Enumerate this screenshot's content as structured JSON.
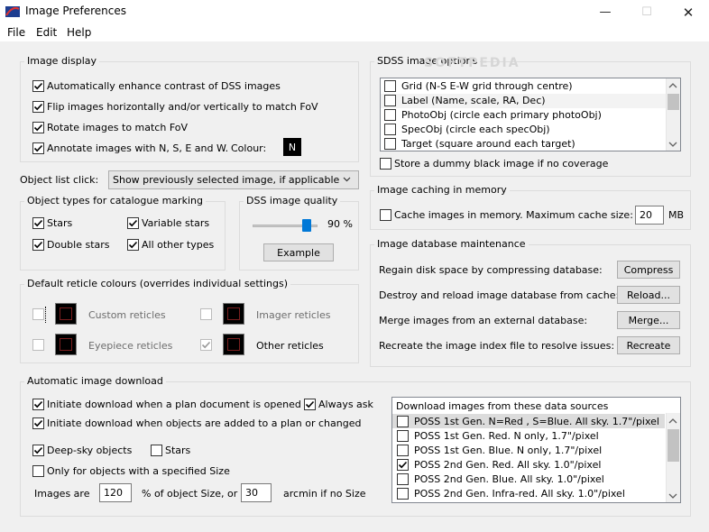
{
  "window": {
    "title": "Image Preferences"
  },
  "menu": [
    "File",
    "Edit",
    "Help"
  ],
  "watermark": "SOFTPEDIA",
  "image_display": {
    "title": "Image display",
    "items": [
      {
        "label": "Automatically enhance contrast of DSS images",
        "checked": true
      },
      {
        "label": "Flip images horizontally and/or vertically to match FoV",
        "checked": true
      },
      {
        "label": "Rotate images to match FoV",
        "checked": true
      },
      {
        "label": "Annotate images with N, S, E and W.",
        "checked": true
      }
    ],
    "colour_label": "Colour:",
    "colour_value": "N"
  },
  "object_list": {
    "label": "Object list click:",
    "value": "Show previously selected image, if applicable"
  },
  "object_types": {
    "title": "Object types for catalogue marking",
    "items": [
      {
        "label": "Stars",
        "checked": true
      },
      {
        "label": "Variable stars",
        "checked": true
      },
      {
        "label": "Double stars",
        "checked": true
      },
      {
        "label": "All other types",
        "checked": true
      }
    ]
  },
  "dss_quality": {
    "title": "DSS image quality",
    "value": "90 %",
    "level": 0.9,
    "button": "Example"
  },
  "reticle": {
    "title": "Default reticle colours (overrides individual settings)",
    "items": [
      {
        "label": "Custom reticles",
        "checked": false,
        "enabled": false
      },
      {
        "label": "Imager reticles",
        "checked": false,
        "enabled": false
      },
      {
        "label": "Eyepiece reticles",
        "checked": false,
        "enabled": false
      },
      {
        "label": "Other reticles",
        "checked": true,
        "enabled": true
      }
    ]
  },
  "sdss": {
    "title": "SDSS image options",
    "items": [
      {
        "label": "Grid (N-S E-W grid through centre)",
        "checked": false
      },
      {
        "label": "Label (Name, scale, RA, Dec)",
        "checked": false
      },
      {
        "label": "PhotoObj (circle each primary photoObj)",
        "checked": false
      },
      {
        "label": "SpecObj (circle each specObj)",
        "checked": false
      },
      {
        "label": "Target (square around each target)",
        "checked": false
      }
    ],
    "dummy_label": "Store a dummy black image if no coverage"
  },
  "caching": {
    "title": "Image caching in memory",
    "label": "Cache images in memory.  Maximum cache size:",
    "value": "20",
    "unit": "MB"
  },
  "db": {
    "title": "Image database maintenance",
    "rows": [
      {
        "label": "Regain disk space by compressing database:",
        "button": "Compress"
      },
      {
        "label": "Destroy and reload image database from cache:",
        "button": "Reload..."
      },
      {
        "label": "Merge images from an external database:",
        "button": "Merge..."
      },
      {
        "label": "Recreate the image index file to resolve issues:",
        "button": "Recreate"
      }
    ]
  },
  "auto_download": {
    "title": "Automatic image download",
    "plan_opened": "Initiate download when a plan document is opened",
    "always_ask": "Always ask",
    "objects_added": "Initiate download when objects are added to a plan or changed",
    "deep_sky": "Deep-sky objects",
    "stars": "Stars",
    "only_size": "Only for objects with a specified Size",
    "images_are": "Images are",
    "size_value": "120",
    "percent_label": "% of object Size, or",
    "arcmin_value": "30",
    "arcmin_label": "arcmin if no Size"
  },
  "sources": {
    "header": "Download images from these data sources",
    "items": [
      {
        "label": "POSS 1st Gen. N=Red , S=Blue. All sky. 1.7\"/pixel",
        "checked": false
      },
      {
        "label": "POSS 1st Gen. Red. N only, 1.7\"/pixel",
        "checked": false
      },
      {
        "label": "POSS 1st Gen. Blue. N only, 1.7\"/pixel",
        "checked": false
      },
      {
        "label": "POSS 2nd Gen. Red. All sky. 1.0\"/pixel",
        "checked": true
      },
      {
        "label": "POSS 2nd Gen. Blue. All sky. 1.0\"/pixel",
        "checked": false
      },
      {
        "label": "POSS 2nd Gen. Infra-red. All sky. 1.0\"/pixel",
        "checked": false
      }
    ]
  }
}
